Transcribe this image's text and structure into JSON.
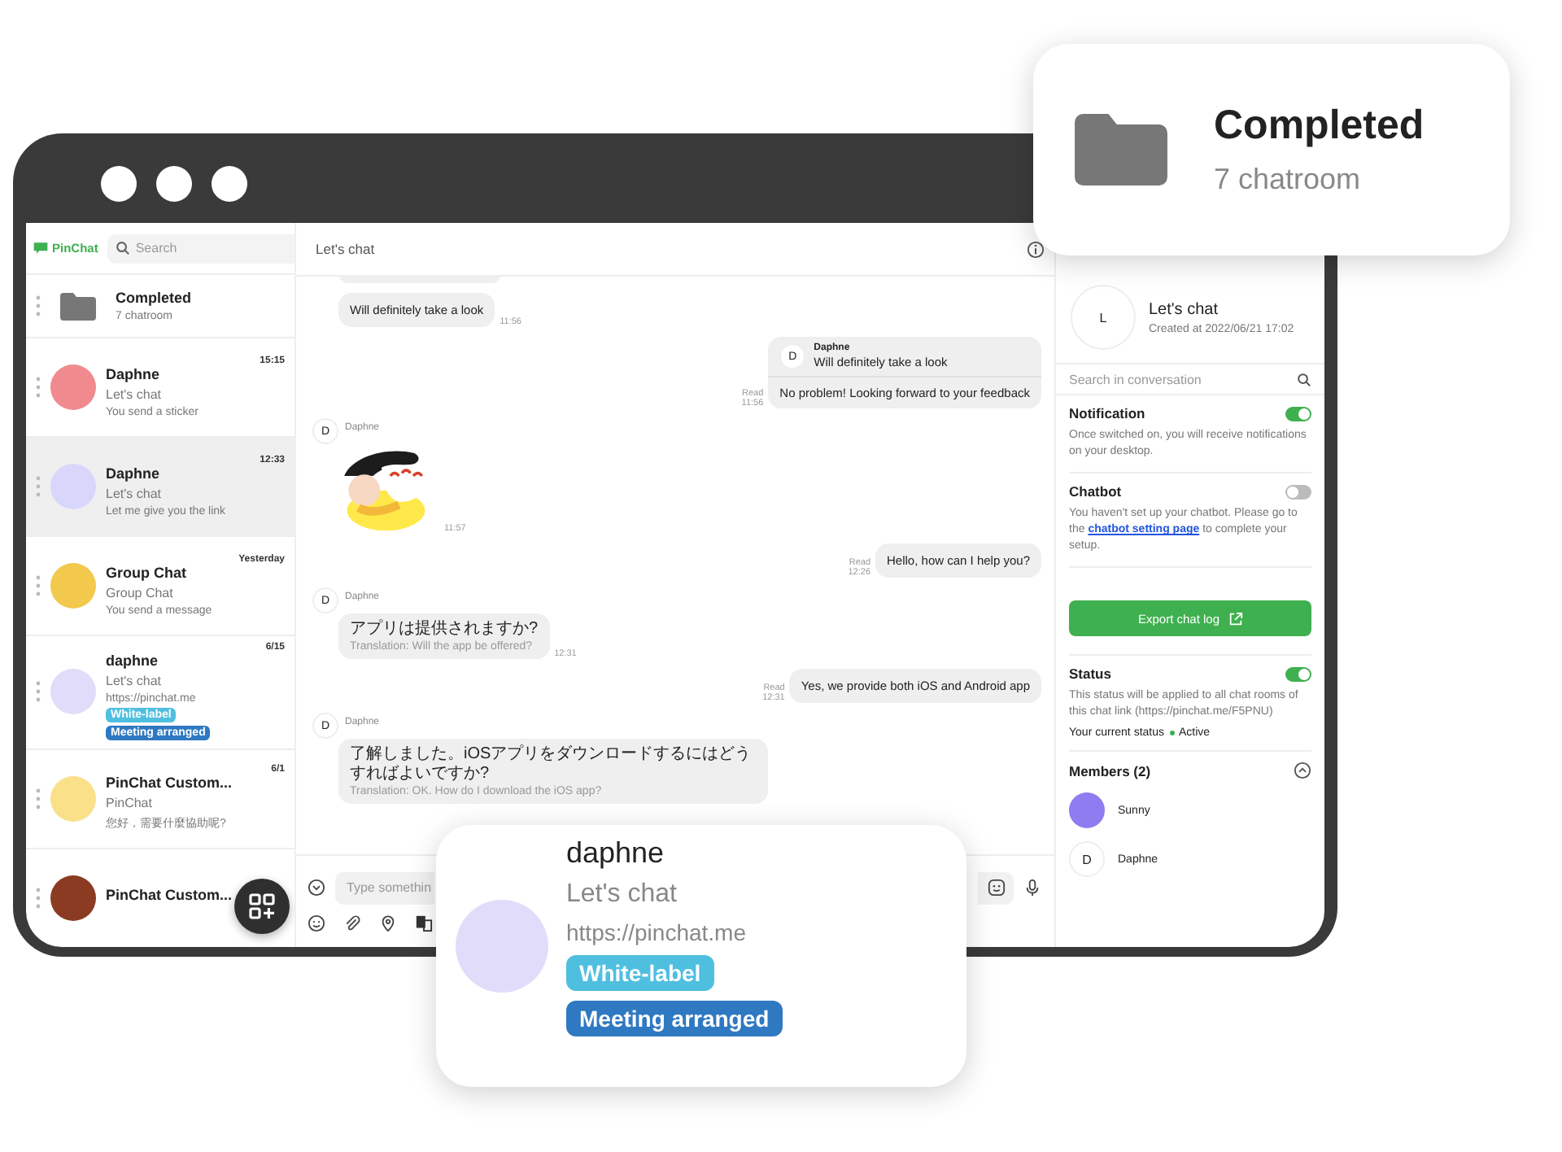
{
  "sidebar": {
    "logo": "PinChat",
    "search": {
      "placeholder": "Search"
    },
    "chats": [
      {
        "kind": "folder",
        "title": "Completed",
        "subtitle": "7 chatroom",
        "selected": false
      },
      {
        "kind": "chat",
        "time": "15:15",
        "name": "Daphne",
        "room": "Let's chat",
        "preview": "You send a sticker",
        "color": "#f08a8e",
        "selected": false
      },
      {
        "kind": "chat",
        "time": "12:33",
        "name": "Daphne",
        "room": "Let's chat",
        "preview": "Let me give you the link",
        "color": "#d9d6fb",
        "selected": true
      },
      {
        "kind": "chat",
        "time": "Yesterday",
        "name": "Group Chat",
        "room": "Group Chat",
        "preview": "You send a message",
        "color": "#f2c94c",
        "selected": false
      },
      {
        "kind": "chat",
        "time": "6/15",
        "name": "daphne",
        "room": "Let's chat",
        "preview": "https://pinchat.me",
        "color": "#e2dcfb",
        "selected": false,
        "tags": [
          {
            "label": "White-label",
            "color": "#4fbfe0"
          },
          {
            "label": "Meeting arranged",
            "color": "#2f78c2"
          }
        ]
      },
      {
        "kind": "chat",
        "time": "6/1",
        "name": "PinChat Custom...",
        "room": "PinChat",
        "preview": "您好，需要什麼協助呢?",
        "color": "#fbe08a",
        "selected": false
      },
      {
        "kind": "chat",
        "name": "PinChat Custom...",
        "color": "#8a3b22",
        "selected": false
      }
    ]
  },
  "chat": {
    "title": "Let's chat",
    "messages": [
      {
        "kind": "in_text",
        "text": "Will definitely take a look",
        "time": "11:56"
      },
      {
        "kind": "out_reply",
        "quote_avatar": "D",
        "quote_name": "Daphne",
        "quote_text": "Will definitely take a look",
        "text": "No problem! Looking forward to your feedback",
        "status": "Read",
        "time": "11:56"
      },
      {
        "kind": "in_sticker",
        "avatar": "D",
        "sender": "Daphne",
        "time": "11:57"
      },
      {
        "kind": "out_text",
        "text": "Hello, how can I help you?",
        "status": "Read",
        "time": "12:26"
      },
      {
        "kind": "in_translated",
        "avatar": "D",
        "sender": "Daphne",
        "text": "アプリは提供されますか?",
        "translation": "Translation: Will the app be offered?",
        "time": "12:31"
      },
      {
        "kind": "out_text",
        "text": "Yes, we provide both iOS and Android app",
        "status": "Read",
        "time": "12:31"
      },
      {
        "kind": "in_translated",
        "avatar": "D",
        "sender": "Daphne",
        "text": "了解しました。iOSアプリをダウンロードするにはどうすればよいですか?",
        "translation": "Translation: OK. How do I download the iOS app?"
      }
    ],
    "composer": {
      "placeholder": "Type somethin"
    }
  },
  "details": {
    "avatar": "L",
    "title": "Let's chat",
    "created": "Created at 2022/06/21 17:02",
    "search": {
      "placeholder": "Search in conversation"
    },
    "notification": {
      "title": "Notification",
      "on": true,
      "text": "Once switched on, you will receive notifications on your desktop."
    },
    "chatbot": {
      "title": "Chatbot",
      "on": false,
      "text_before": "You haven't set up your chatbot. Please go to the ",
      "link": "chatbot setting page",
      "text_after": " to complete your setup."
    },
    "export_button": "Export chat log",
    "status": {
      "title": "Status",
      "on": true,
      "text": "This status will be applied to all chat rooms of this chat link (https://pinchat.me/F5PNU)",
      "current_label": "Your current status",
      "current": "Active"
    },
    "members": {
      "title": "Members (2)",
      "expanded": true,
      "list": [
        {
          "name": "Sunny",
          "color": "#8f7cf0"
        },
        {
          "name": "Daphne",
          "initial": "D"
        }
      ]
    }
  },
  "callouts": {
    "folder": {
      "title": "Completed",
      "subtitle": "7 chatroom"
    },
    "contact": {
      "name": "daphne",
      "room": "Let's chat",
      "link": "https://pinchat.me",
      "color": "#e2dcfb",
      "tags": [
        {
          "label": "White-label",
          "color": "#4fbfe0"
        },
        {
          "label": "Meeting arranged",
          "color": "#2f78c2"
        }
      ]
    }
  }
}
